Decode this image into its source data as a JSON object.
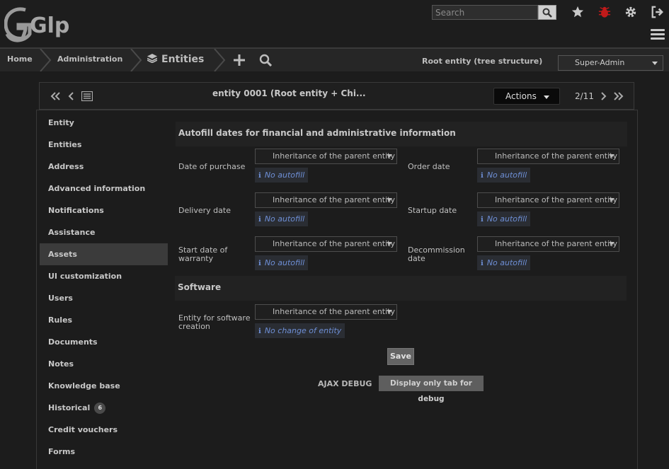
{
  "header": {
    "logo_text": "Glpi",
    "search_placeholder": "Search"
  },
  "icons": {
    "search": "search-icon",
    "favorites": "star-icon",
    "debug": "bug-icon",
    "preferences": "gear-icon",
    "logout": "logout-icon",
    "menu": "hamburger-icon"
  },
  "colors": {
    "debug_icon": "#c21a1a",
    "active_tab": "#3b3b3b",
    "link": "#6e8fd6"
  },
  "breadcrumb": {
    "home": "Home",
    "administration": "Administration",
    "entities": "Entities"
  },
  "entity_info": "Root entity (tree structure)",
  "profile": "Super-Admin",
  "item": {
    "title": "entity 0001 (Root entity + Chi...",
    "actions": "Actions",
    "pager": "2/11"
  },
  "tabs": [
    {
      "label": "Entity"
    },
    {
      "label": "Entities"
    },
    {
      "label": "Address"
    },
    {
      "label": "Advanced information"
    },
    {
      "label": "Notifications"
    },
    {
      "label": "Assistance"
    },
    {
      "label": "Assets"
    },
    {
      "label": "UI customization"
    },
    {
      "label": "Users"
    },
    {
      "label": "Rules"
    },
    {
      "label": "Documents"
    },
    {
      "label": "Notes"
    },
    {
      "label": "Knowledge base"
    },
    {
      "label": "Historical",
      "badge": "6"
    },
    {
      "label": "Credit vouchers"
    },
    {
      "label": "Forms"
    }
  ],
  "active_tab": "Assets",
  "form": {
    "section1": "Autofill dates for financial and administrative information",
    "inherit": "Inheritance of the parent entity",
    "no_autofill": "No autofill",
    "date_of_purchase": "Date of purchase",
    "order_date": "Order date",
    "delivery_date": "Delivery date",
    "startup_date": "Startup date",
    "warranty_line1": "Start date of",
    "warranty_line2": "warranty",
    "decommission_line1": "Decommission",
    "decommission_line2": "date",
    "section2": "Software",
    "software_line1": "Entity for software",
    "software_line2": "creation",
    "no_change": "No change of entity",
    "save": "Save"
  },
  "debug": {
    "label": "AJAX DEBUG",
    "button": "Display only tab for debug"
  }
}
